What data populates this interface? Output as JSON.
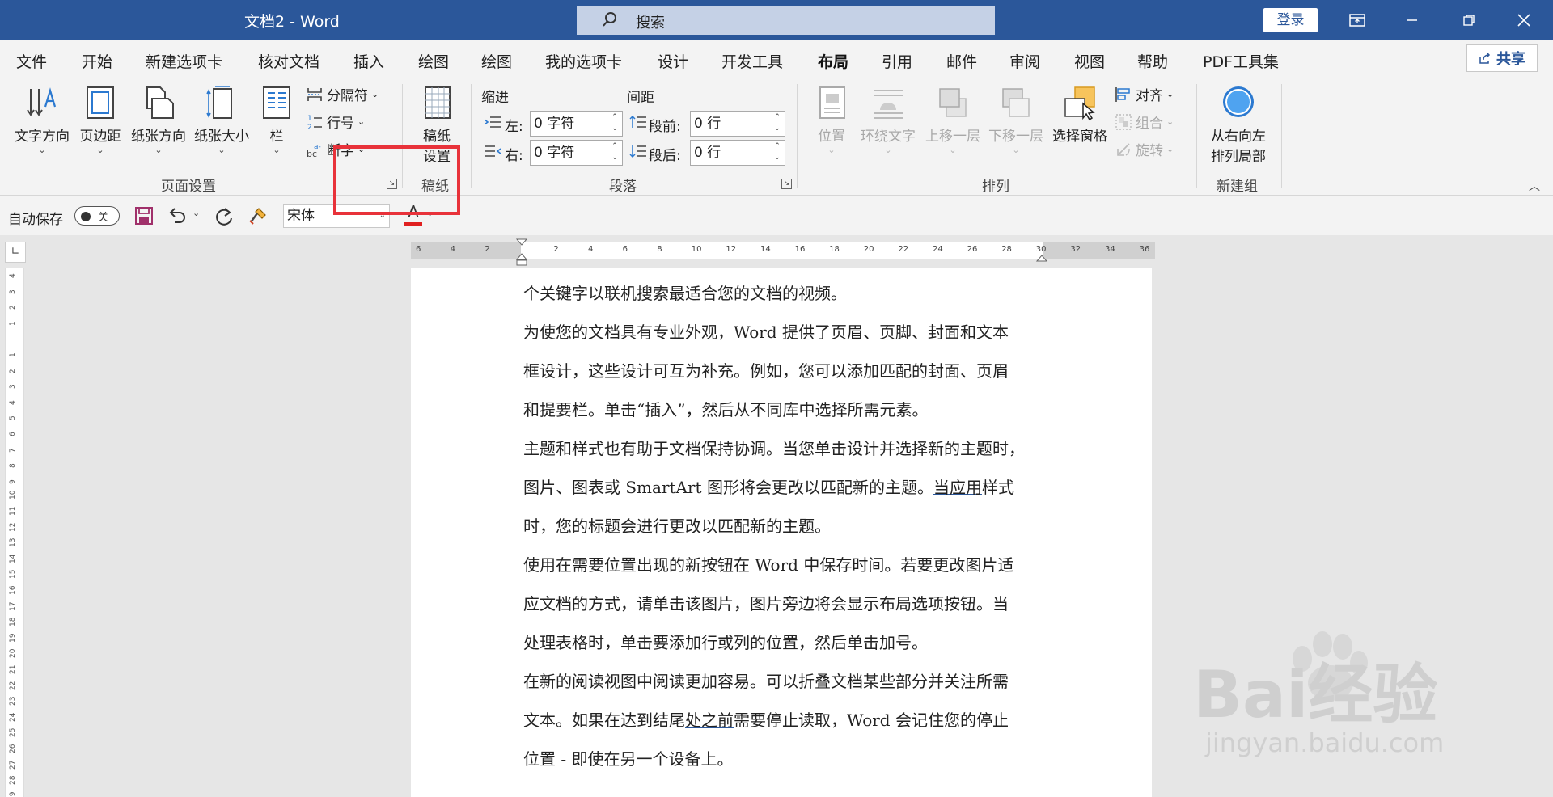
{
  "window": {
    "title": "文档2  -  Word",
    "search_placeholder": "搜索",
    "login": "登录",
    "controls": [
      "minimize-icon",
      "restore-icon",
      "close-icon"
    ]
  },
  "tabs": [
    "文件",
    "开始",
    "新建选项卡",
    "核对文档",
    "插入",
    "绘图",
    "绘图",
    "我的选项卡",
    "设计",
    "开发工具",
    "布局",
    "引用",
    "邮件",
    "审阅",
    "视图",
    "帮助",
    "PDF工具集"
  ],
  "active_tab": "布局",
  "share": "共享",
  "ribbon": {
    "page_setup": {
      "label": "页面设置",
      "text_direction": "文字方向",
      "margins": "页边距",
      "orientation": "纸张方向",
      "size": "纸张大小",
      "columns": "栏",
      "breaks": "分隔符",
      "line_numbers": "行号",
      "hyphenation": "断字"
    },
    "manuscript": {
      "label": "稿纸",
      "button_line1": "稿纸",
      "button_line2": "设置"
    },
    "paragraph": {
      "label": "段落",
      "indent_title": "缩进",
      "spacing_title": "间距",
      "left_label": "左:",
      "right_label": "右:",
      "left_value": "0 字符",
      "right_value": "0 字符",
      "before_label": "段前:",
      "after_label": "段后:",
      "before_value": "0 行",
      "after_value": "0 行"
    },
    "arrange": {
      "label": "排列",
      "position": "位置",
      "wrap_text": "环绕文字",
      "bring_forward": "上移一层",
      "send_backward": "下移一层",
      "selection_pane": "选择窗格",
      "align": "对齐",
      "group": "组合",
      "rotate": "旋转"
    },
    "new_group": {
      "label": "新建组",
      "rtl_line1": "从右向左",
      "rtl_line2": "排列局部"
    }
  },
  "qat": {
    "autosave": "自动保存",
    "toggle": "关",
    "font": "宋体",
    "font_color_letter": "A"
  },
  "ruler": {
    "h_ticks": [
      "6",
      "4",
      "2",
      "",
      "2",
      "4",
      "6",
      "8",
      "10",
      "12",
      "14",
      "16",
      "18",
      "20",
      "22",
      "24",
      "26",
      "28",
      "30",
      "32",
      "34",
      "36"
    ],
    "v_ticks": [
      "4",
      "3",
      "2",
      "1",
      "",
      "1",
      "2",
      "3",
      "4",
      "5",
      "6",
      "7",
      "8",
      "9",
      "10",
      "11",
      "12",
      "13",
      "14",
      "15",
      "16",
      "17",
      "18",
      "19",
      "20",
      "21",
      "22",
      "23",
      "24",
      "25",
      "26",
      "27",
      "28",
      "29"
    ]
  },
  "document": {
    "lines": [
      {
        "text": "个关键字以联机搜索最适合您的文档的视频。"
      },
      {
        "text": "为使您的文档具有专业外观，Word 提供了页眉、页脚、封面和文本"
      },
      {
        "text": "框设计，这些设计可互为补充。例如，您可以添加匹配的封面、页眉"
      },
      {
        "text": "和提要栏。单击“插入”，然后从不同库中选择所需元素。"
      },
      {
        "text": "主题和样式也有助于文档保持协调。当您单击设计并选择新的主题时，"
      },
      {
        "pre": "图片、图表或 SmartArt 图形将会更改以匹配新的主题。",
        "ul": "当应用",
        "post": "样式"
      },
      {
        "text": "时，您的标题会进行更改以匹配新的主题。"
      },
      {
        "text": "使用在需要位置出现的新按钮在 Word 中保存时间。若要更改图片适"
      },
      {
        "text": "应文档的方式，请单击该图片，图片旁边将会显示布局选项按钮。当"
      },
      {
        "text": "处理表格时，单击要添加行或列的位置，然后单击加号。"
      },
      {
        "text": "在新的阅读视图中阅读更加容易。可以折叠文档某些部分并关注所需"
      },
      {
        "pre": "文本。如果在达到结尾",
        "ul": "处之前",
        "post": "需要停止读取，Word 会记住您的停止"
      },
      {
        "text": "位置 - 即使在另一个设备上。"
      }
    ]
  },
  "watermark": {
    "brand": "Bai经验",
    "url": "jingyan.baidu.com"
  },
  "colors": {
    "accent": "#2b579a",
    "highlight": "#e8323a",
    "font_color": "#e02020"
  }
}
